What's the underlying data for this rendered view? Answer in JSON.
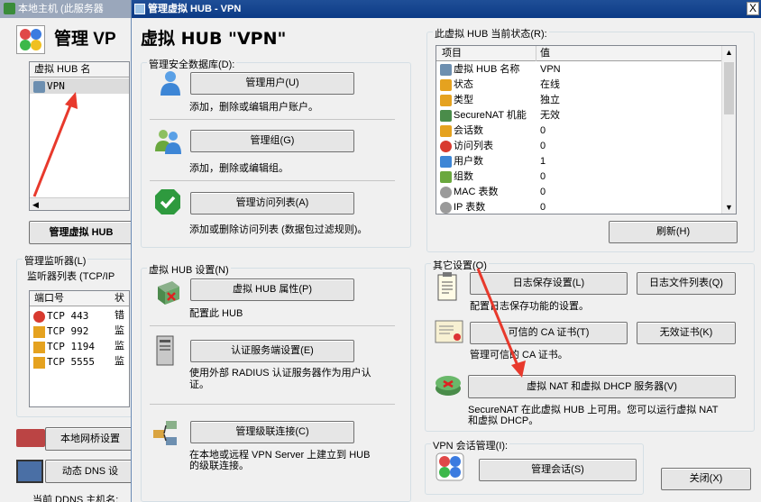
{
  "bg": {
    "title": "本地主机 (此服务器",
    "manage_title": "管理 VP",
    "hub_list_header": "虚拟 HUB 名",
    "hub_list_items": [
      "VPN"
    ],
    "manage_hub_btn": "管理虚拟 HUB",
    "listener_group": "管理监听器(L)",
    "listener_desc": "监听器列表 (TCP/IP",
    "listener_headers": [
      "端口号",
      "状"
    ],
    "listeners": [
      {
        "port": "TCP 443",
        "status": "错"
      },
      {
        "port": "TCP 992",
        "status": "监"
      },
      {
        "port": "TCP 1194",
        "status": "监"
      },
      {
        "port": "TCP 5555",
        "status": "监"
      }
    ],
    "bridge_btn": "本地网桥设置",
    "ddns_btn": "动态 DNS 设",
    "ddns_label": "当前 DDNS 主机名:"
  },
  "dlg": {
    "title": "管理虚拟 HUB - VPN",
    "close_glyph": "X",
    "heading": "虚拟 HUB \"VPN\"",
    "secdb_group": "管理安全数据库(D):",
    "users_btn": "管理用户(U)",
    "users_desc": "添加，删除或编辑用户账户。",
    "groups_btn": "管理组(G)",
    "groups_desc": "添加，删除或编辑组。",
    "acl_btn": "管理访问列表(A)",
    "acl_desc": "添加或删除访问列表 (数据包过滤规则)。",
    "hubsettings_group": "虚拟 HUB 设置(N)",
    "props_btn": "虚拟 HUB 属性(P)",
    "props_desc": "配置此 HUB",
    "auth_btn": "认证服务端设置(E)",
    "auth_desc_1": "使用外部 RADIUS 认证服务器作为用户认",
    "auth_desc_2": "证。",
    "cascade_btn": "管理级联连接(C)",
    "cascade_desc_1": "在本地或远程 VPN Server 上建立到 HUB",
    "cascade_desc_2": "的级联连接。",
    "status_group": "此虚拟 HUB 当前状态(R):",
    "status_headers": [
      "项目",
      "值"
    ],
    "status_rows": [
      {
        "icon": "hub-icon",
        "item": "虚拟 HUB 名称",
        "value": "VPN"
      },
      {
        "icon": "status-icon",
        "item": "状态",
        "value": "在线"
      },
      {
        "icon": "type-icon",
        "item": "类型",
        "value": "独立"
      },
      {
        "icon": "securenat-icon",
        "item": "SecureNAT 机能",
        "value": "无效"
      },
      {
        "icon": "session-icon",
        "item": "会话数",
        "value": "0"
      },
      {
        "icon": "acl-icon",
        "item": "访问列表",
        "value": "0"
      },
      {
        "icon": "user-icon",
        "item": "用户数",
        "value": "1"
      },
      {
        "icon": "group-icon",
        "item": "组数",
        "value": "0"
      },
      {
        "icon": "mac-table-icon",
        "item": "MAC 表数",
        "value": "0"
      },
      {
        "icon": "ip-table-icon",
        "item": "IP 表数",
        "value": "0"
      }
    ],
    "refresh_btn": "刷新(H)",
    "other_group": "其它设置(O)",
    "log_btn": "日志保存设置(L)",
    "logfiles_btn": "日志文件列表(Q)",
    "log_desc": "配置日志保存功能的设置。",
    "ca_btn": "可信的 CA 证书(T)",
    "revoked_btn": "无效证书(K)",
    "ca_desc": "管理可信的 CA 证书。",
    "nat_btn": "虚拟 NAT 和虚拟 DHCP 服务器(V)",
    "nat_desc_1": "SecureNAT 在此虚拟 HUB 上可用。您可以运行虚拟 NAT",
    "nat_desc_2": "和虚拟 DHCP。",
    "session_group": "VPN 会话管理(I):",
    "session_btn": "管理会话(S)",
    "close_btn": "关闭(X)"
  },
  "colors": {
    "title_bar": "#0c3b86",
    "arrow": "#e8392c"
  }
}
